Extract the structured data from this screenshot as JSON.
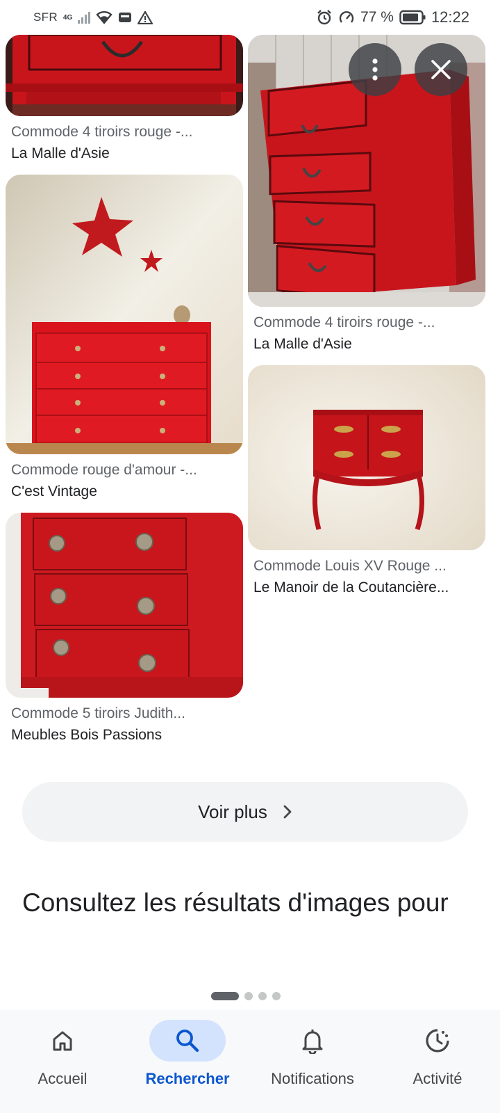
{
  "status_bar": {
    "carrier": "SFR",
    "network": "4G",
    "battery_percent": "77 %",
    "time": "12:22",
    "icons": [
      "signal-icon",
      "wifi-icon",
      "sim-icon",
      "warning-icon",
      "alarm-icon",
      "data-saver-icon",
      "battery-icon"
    ]
  },
  "overlay": {
    "more_icon": "more-vert-icon",
    "close_icon": "close-icon"
  },
  "results": {
    "left": [
      {
        "title": "Commode 4 tiroirs rouge -...",
        "source": "La Malle d'Asie"
      },
      {
        "title": "Commode rouge d'amour -...",
        "source": "C'est Vintage"
      },
      {
        "title": "Commode 5 tiroirs Judith...",
        "source": "Meubles Bois Passions"
      }
    ],
    "right": [
      {
        "title": "Commode 4 tiroirs rouge -...",
        "source": "La Malle d'Asie"
      },
      {
        "title": "Commode Louis XV Rouge ...",
        "source": "Le Manoir de la Coutancière..."
      }
    ]
  },
  "more_button": {
    "label": "Voir plus",
    "icon": "chevron-right-icon"
  },
  "section": {
    "title": "Consultez les résultats d'images pour"
  },
  "carousel": {
    "pages": 4,
    "active": 1
  },
  "bottom_nav": {
    "items": [
      {
        "label": "Accueil",
        "icon": "home-icon"
      },
      {
        "label": "Rechercher",
        "icon": "search-icon",
        "active": true
      },
      {
        "label": "Notifications",
        "icon": "bell-icon"
      },
      {
        "label": "Activité",
        "icon": "activity-icon"
      }
    ]
  },
  "colors": {
    "accent": "#0b57d0",
    "accent_bg": "#d3e3fd",
    "furniture_red": "#c8151c"
  }
}
